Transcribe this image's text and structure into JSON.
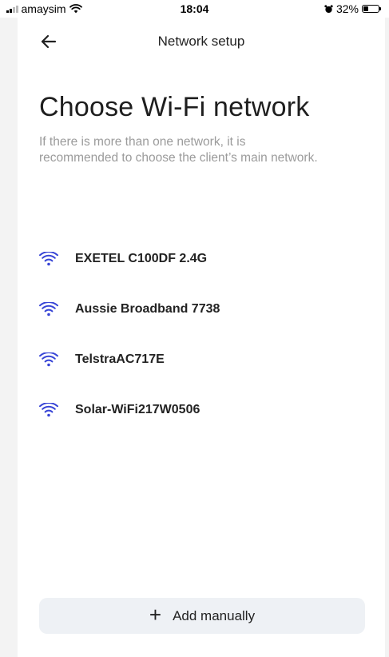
{
  "status_bar": {
    "carrier": "amaysim",
    "time": "18:04",
    "battery_percent": "32%",
    "battery_level": 0.32
  },
  "header": {
    "title": "Network setup",
    "back_icon": "arrow-left-icon"
  },
  "page": {
    "heading": "Choose Wi-Fi network",
    "description": "If there is more than one network, it is recommended to choose the client’s main network."
  },
  "networks": [
    {
      "name": "EXETEL C100DF 2.4G",
      "icon": "wifi-icon"
    },
    {
      "name": "Aussie Broadband 7738",
      "icon": "wifi-icon"
    },
    {
      "name": "TelstraAC717E",
      "icon": "wifi-icon"
    },
    {
      "name": "Solar-WiFi217W0506",
      "icon": "wifi-icon"
    }
  ],
  "actions": {
    "add_manually_label": "Add manually",
    "add_icon": "plus-icon"
  },
  "colors": {
    "wifi_accent": "#3845d6",
    "button_bg": "#eef1f5",
    "description_text": "#9b9b9b"
  }
}
